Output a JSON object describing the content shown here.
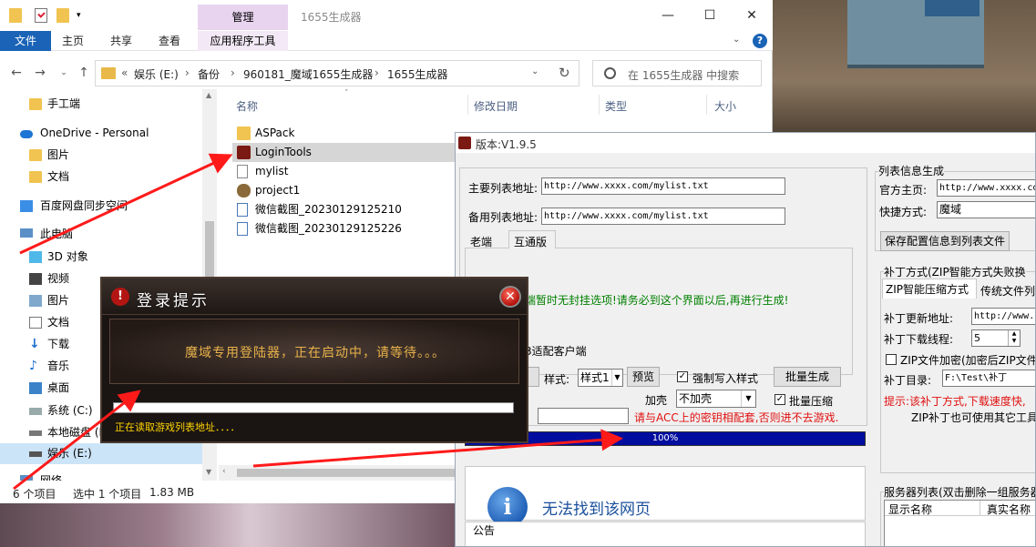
{
  "explorer": {
    "window_title": "1655生成器",
    "manage_tab": "管理",
    "ribbon": {
      "file": "文件",
      "home": "主页",
      "share": "共享",
      "view": "查看",
      "app_tools": "应用程序工具"
    },
    "address": {
      "overflow": "«",
      "crumbs": [
        "娱乐 (E:)",
        "备份",
        "960181_魔域1655生成器",
        "1655生成器"
      ]
    },
    "search_placeholder": "在 1655生成器 中搜索",
    "nav": [
      {
        "label": "手工端"
      },
      {
        "label": "OneDrive - Personal"
      },
      {
        "label": "图片"
      },
      {
        "label": "文档"
      },
      {
        "label": "百度网盘同步空间"
      },
      {
        "label": "此电脑"
      },
      {
        "label": "3D 对象"
      },
      {
        "label": "视频"
      },
      {
        "label": "图片"
      },
      {
        "label": "文档"
      },
      {
        "label": "下载"
      },
      {
        "label": "音乐"
      },
      {
        "label": "桌面"
      },
      {
        "label": "系统 (C:)"
      },
      {
        "label": "本地磁盘 (D:)"
      },
      {
        "label": "娱乐 (E:)"
      },
      {
        "label": "网络"
      }
    ],
    "columns": {
      "name": "名称",
      "date": "修改日期",
      "type": "类型",
      "size": "大小"
    },
    "files": [
      {
        "name": "ASPack",
        "icon": "folder-icon"
      },
      {
        "name": "LoginTools",
        "icon": "app-icon"
      },
      {
        "name": "mylist",
        "icon": "text-file-icon"
      },
      {
        "name": "project1",
        "icon": "app-icon"
      },
      {
        "name": "微信截图_20230129125210",
        "icon": "image-file-icon"
      },
      {
        "name": "微信截图_20230129125226",
        "icon": "image-file-icon"
      }
    ],
    "status": {
      "count": "6 个项目",
      "selected": "选中 1 个项目",
      "size": "1.83 MB"
    }
  },
  "generator": {
    "title": "版本:V1.9.5",
    "main_list_label": "主要列表地址:",
    "main_list_value": "http://www.xxxx.com/mylist.txt",
    "backup_list_label": "备用列表地址:",
    "backup_list_value": "http://www.xxxx.com/mylist.txt",
    "tabs": [
      "老端",
      "互通版"
    ],
    "notice": "端暂时无封挂选项!请务必到这个界面以后,再进行生成!",
    "client_note": "3适配客户端",
    "style_label": "样式:",
    "style_value": "样式1",
    "preview_btn": "预览",
    "force_write": "强制写入样式",
    "batch_gen_btn": "批量生成",
    "shell_label": "加壳",
    "shell_value": "不加壳",
    "batch_compress": "批量压缩",
    "acc_warning": "请与ACC上的密钥相配套,否则进不去游戏.",
    "progress": "100%",
    "page_not_found": "无法找到该网页",
    "announcement": "公告",
    "right": {
      "list_info_title": "列表信息生成",
      "homepage_label": "官方主页:",
      "homepage_value": "http://www.xxxx.com",
      "shortcut_label": "快捷方式:",
      "shortcut_value": "魔域",
      "save_btn": "保存配置信息到列表文件",
      "patch_group": "补丁方式(ZIP智能方式失败换",
      "patch_tabs": [
        "ZIP智能压缩方式",
        "传统文件列"
      ],
      "patch_url_label": "补丁更新地址:",
      "patch_url_value": "http://www.x",
      "threads_label": "补丁下载线程:",
      "threads_value": "5",
      "zip_encrypt": "ZIP文件加密(加密后ZIP文件",
      "patch_dir_label": "补丁目录:",
      "patch_dir_value": "F:\\Test\\补丁",
      "hint1": "提示:该补丁方式,下载速度快,",
      "hint2": "ZIP补丁也可使用其它工具",
      "server_list_title": "服务器列表(双击删除一组服务器",
      "col_display": "显示名称",
      "col_real": "真实名称"
    }
  },
  "login": {
    "title": "登录提示",
    "message": "魔域专用登陆器，正在启动中，请等待。。。",
    "status": "正在读取游戏列表地址．．．．",
    "close": "✕",
    "warn": "!"
  },
  "colors": {
    "accent": "#1a63b6",
    "arrow": "#ff1a1a",
    "progress": "#000d9e",
    "login_text": "#e8b24a",
    "login_status": "#ffd400"
  }
}
